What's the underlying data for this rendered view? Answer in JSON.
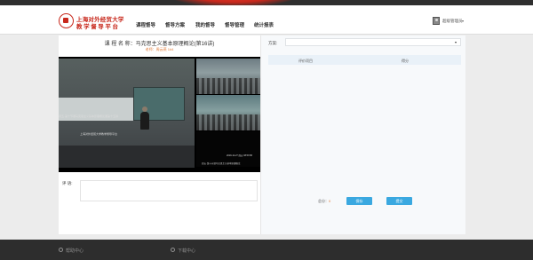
{
  "brand": {
    "line1": "上海对外经贸大学",
    "line2": "教学督导平台"
  },
  "nav": [
    {
      "label": "课程督导"
    },
    {
      "label": "督导方案"
    },
    {
      "label": "我的督导"
    },
    {
      "label": "督导管理"
    },
    {
      "label": "统计报表"
    }
  ],
  "user": {
    "name": "超级管理员",
    "caret": "▾"
  },
  "course": {
    "title": "课 程 名 称：马克思主义基本原理概论(第16讲)",
    "subtitle": "老师：周云燕 1#4"
  },
  "video": {
    "main_caption": "周五·第十节课马克思主义基本原理概论课第十五讲",
    "main_caption2": "上海对外经贸大学教学督导平台",
    "thumb3_timestamp": "2019-12-27 周五 08:53:58",
    "thumb3_caption": "周五·第十节课马克思主义基本原理概论"
  },
  "remark": {
    "label": "评 语:"
  },
  "scheme": {
    "label": "方案:",
    "value": "",
    "caret": "▾"
  },
  "table": {
    "headers": [
      "评价项目",
      "得分"
    ]
  },
  "total": {
    "label": "总分：",
    "value": "0"
  },
  "buttons": {
    "save": "保存",
    "submit": "提交"
  },
  "footer": {
    "help": "帮助中心",
    "download": "下载中心"
  },
  "colors": {
    "brand": "#c8281c",
    "accent": "#3aa8e0",
    "score": "#e07b3a"
  }
}
